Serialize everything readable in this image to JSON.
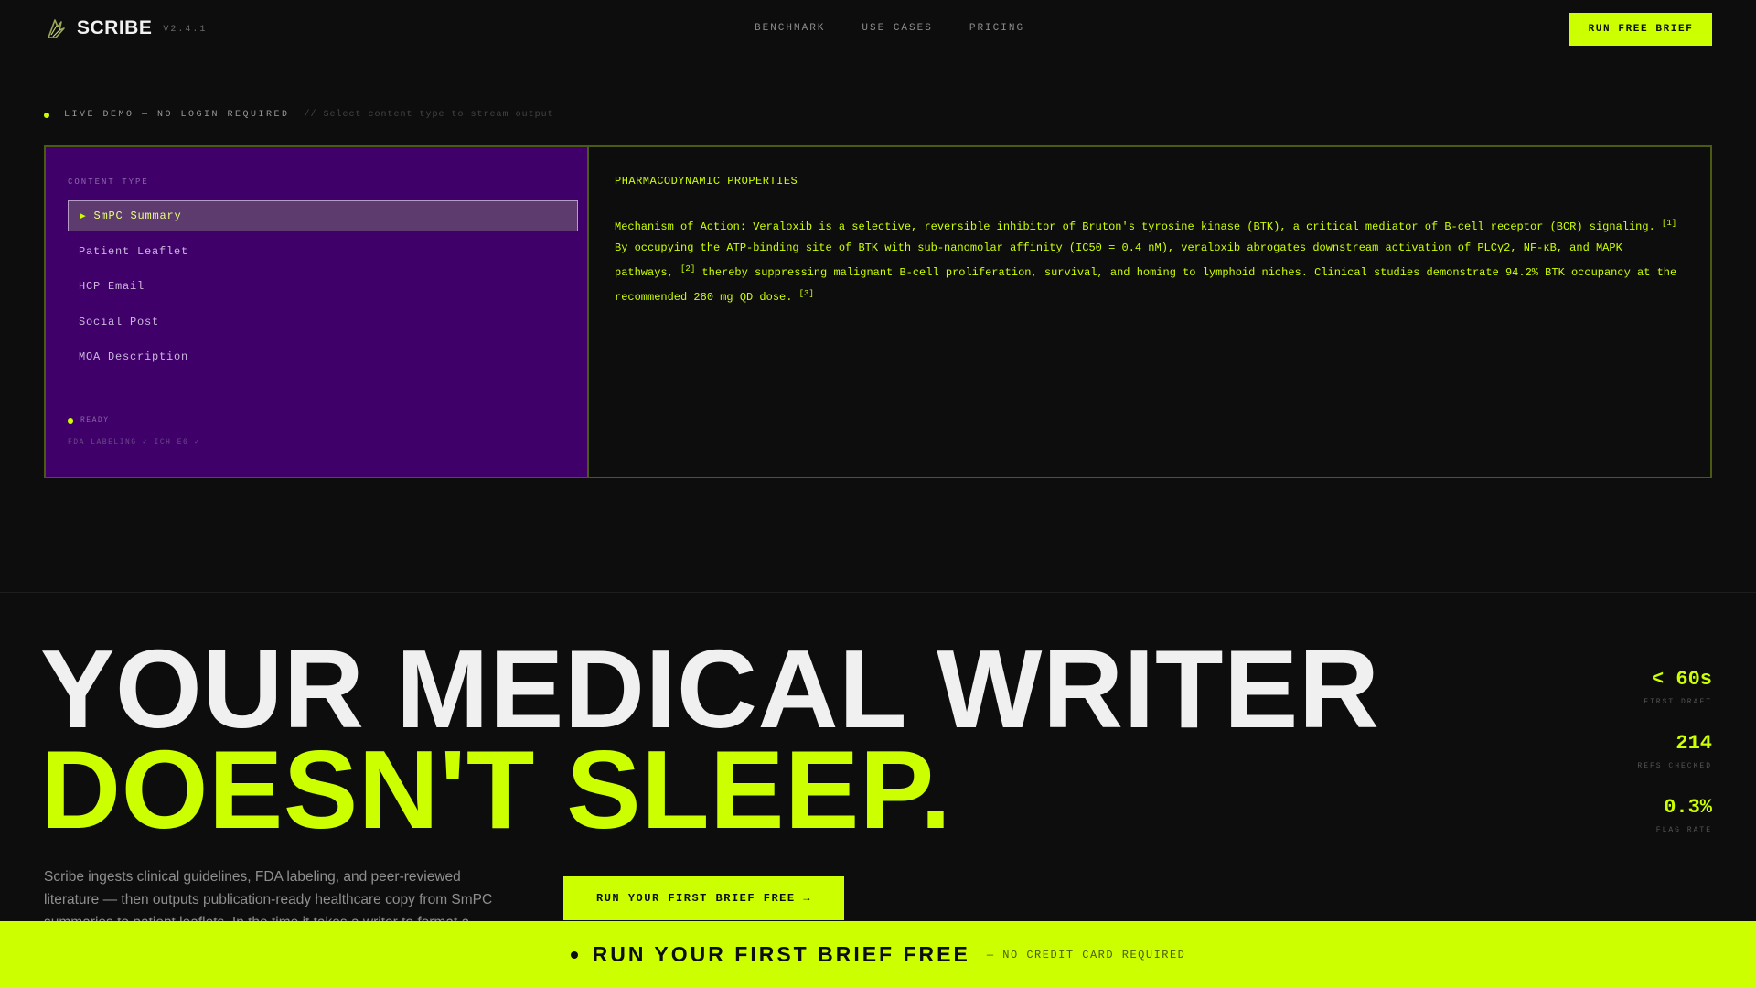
{
  "nav": {
    "brand": "SCRIBE",
    "version": "V2.4.1",
    "links": [
      "BENCHMARK",
      "USE CASES",
      "PRICING"
    ],
    "cta": "RUN FREE BRIEF"
  },
  "demo": {
    "live_label": "LIVE DEMO — NO LOGIN REQUIRED",
    "hint": "// Select content type to stream output",
    "content_type_label": "CONTENT TYPE",
    "items": [
      {
        "label": "SmPC Summary",
        "active": true
      },
      {
        "label": "Patient Leaflet"
      },
      {
        "label": "HCP Email"
      },
      {
        "label": "Social Post"
      },
      {
        "label": "MOA Description"
      }
    ],
    "status": "READY",
    "compliance": "FDA LABELING ✓ ICH E6 ✓",
    "output": {
      "title": "PHARMACODYNAMIC PROPERTIES",
      "body_part1": "Mechanism of Action: Veraloxib is a selective, reversible inhibitor of Bruton's tyrosine kinase (BTK), a critical mediator of B-cell receptor (BCR) signaling.",
      "ref1": "[1]",
      "body_part2": "By occupying the ATP-binding site of BTK with sub-nanomolar affinity (IC50 = 0.4 nM), veraloxib abrogates downstream activation of PLCγ2, NF-κB, and MAPK pathways,",
      "ref2": "[2]",
      "body_part3": "thereby suppressing malignant B-cell proliferation, survival, and homing to lymphoid niches. Clinical studies demonstrate 94.2% BTK occupancy at the recommended 280 mg QD dose.",
      "ref3": "[3]"
    }
  },
  "hero": {
    "line1": "YOUR MEDICAL WRITER",
    "line2": "DOESN'T SLEEP.",
    "description": "Scribe ingests clinical guidelines, FDA labeling, and peer-reviewed literature — then outputs publication-ready healthcare copy from SmPC summaries to patient leaflets. In the time it takes a writer to format a header.",
    "cta": "RUN YOUR FIRST BRIEF FREE →"
  },
  "stats": [
    {
      "value": "< 60s",
      "label": "FIRST DRAFT"
    },
    {
      "value": "214",
      "label": "REFS CHECKED"
    },
    {
      "value": "0.3%",
      "label": "FLAG RATE"
    }
  ],
  "bottom_bar": {
    "main": "RUN YOUR FIRST BRIEF FREE",
    "sub": "— NO CREDIT CARD REQUIRED"
  },
  "colors": {
    "accent": "#ccff00",
    "background": "#0d0d0d",
    "panel_purple": "#3f0069",
    "active_item": "#5e3b6f"
  },
  "icons": {
    "logo": "quill-feather-icon",
    "active_marker": "play-arrow-icon",
    "status": "status-dot-icon"
  }
}
